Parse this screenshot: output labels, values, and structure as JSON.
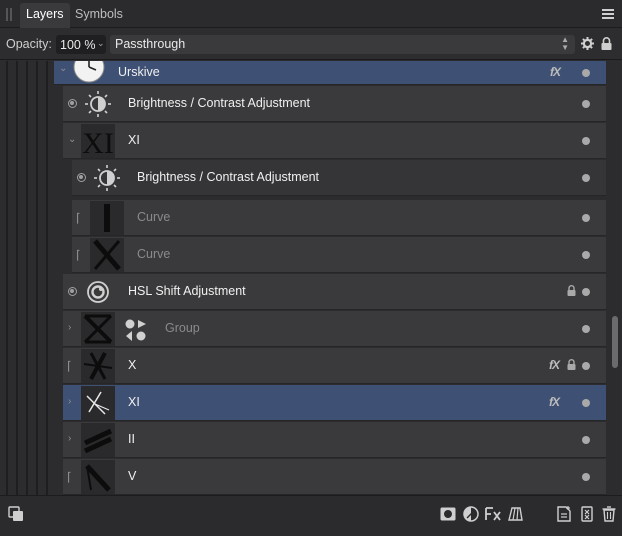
{
  "tabs": [
    {
      "label": "Layers",
      "active": true
    },
    {
      "label": "Symbols",
      "active": false
    }
  ],
  "opacity": {
    "label": "Opacity:",
    "value": "100 %"
  },
  "blend_mode": {
    "value": "Passthrough"
  },
  "layers": [
    {
      "name": "Urskive",
      "fx": "fX"
    },
    {
      "name": "Brightness / Contrast Adjustment"
    },
    {
      "name": "XI",
      "thumb_text": "XI"
    },
    {
      "name": "Brightness / Contrast Adjustment"
    },
    {
      "name": "Curve"
    },
    {
      "name": "Curve"
    },
    {
      "name": "HSL Shift Adjustment"
    },
    {
      "name": "Group"
    },
    {
      "name": "X",
      "fx": "fX"
    },
    {
      "name": "XI",
      "fx": "fX"
    },
    {
      "name": "II"
    },
    {
      "name": "V"
    }
  ],
  "colors": {
    "panel": "#3a3a3c",
    "selected": "#3e5073",
    "background": "#2c2c2e"
  }
}
